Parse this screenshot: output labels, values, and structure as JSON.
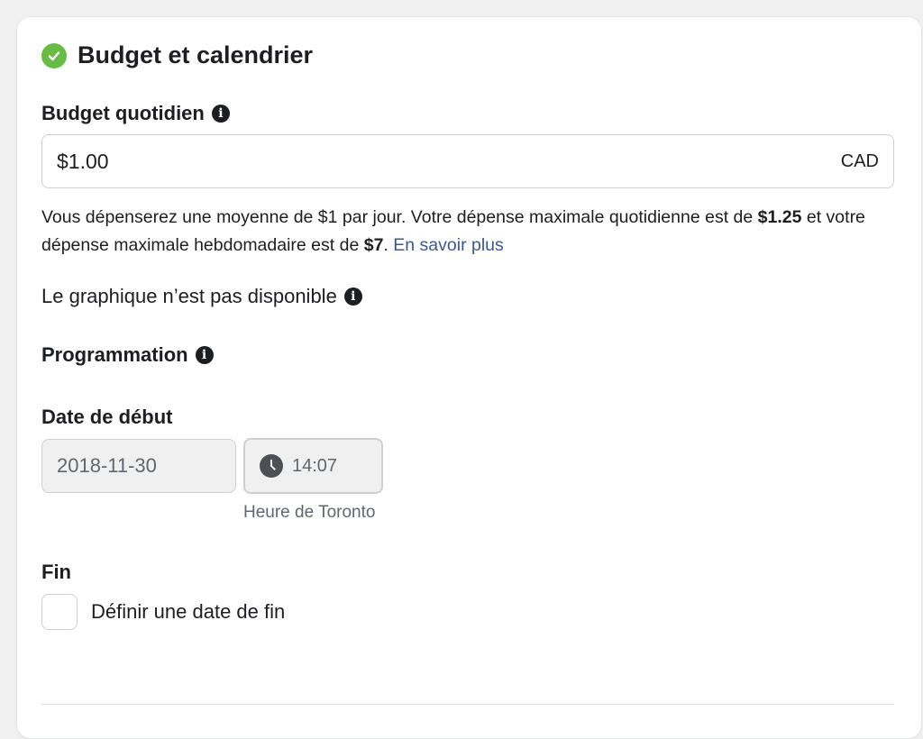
{
  "section": {
    "title": "Budget et calendrier"
  },
  "budget": {
    "label": "Budget quotidien",
    "value": "$1.00",
    "currency": "CAD",
    "desc_prefix": "Vous dépenserez une moyenne de $1 par jour. Votre dépense maximale quotidienne est de ",
    "max_daily": "$1.25",
    "desc_middle": " et votre dépense maximale hebdomadaire est de ",
    "max_weekly": "$7",
    "desc_suffix": ". ",
    "learn_more": "En savoir plus"
  },
  "graph": {
    "note": "Le graphique n’est pas disponible"
  },
  "schedule": {
    "label": "Programmation",
    "start_label": "Date de début",
    "start_date": "2018-11-30",
    "start_time": "14:07",
    "timezone": "Heure de Toronto",
    "end_label": "Fin",
    "end_checkbox_label": "Définir une date de fin"
  },
  "colors": {
    "success": "#67bd44",
    "link": "#385898",
    "text": "#1c1e21",
    "muted": "#606770"
  }
}
